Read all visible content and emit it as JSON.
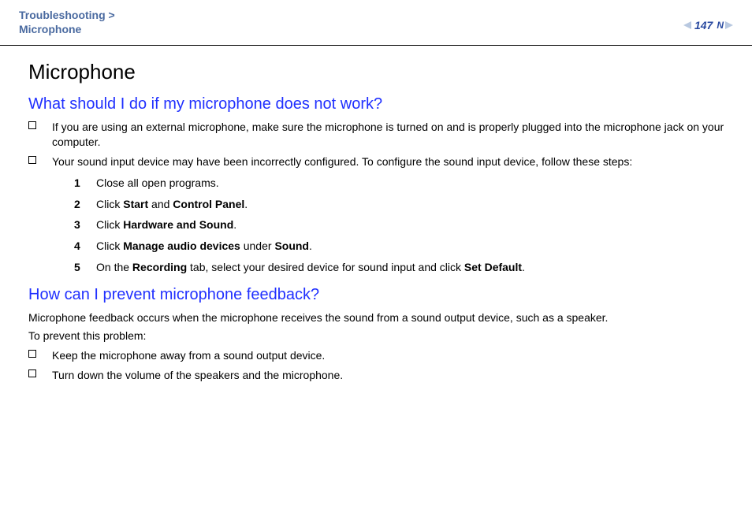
{
  "header": {
    "breadcrumb_section": "Troubleshooting",
    "breadcrumb_sep": ">",
    "breadcrumb_topic": "Microphone",
    "page_number": "147",
    "n_label": "N"
  },
  "content": {
    "title": "Microphone",
    "section1": {
      "heading": "What should I do if my microphone does not work?",
      "bullet1": "If you are using an external microphone, make sure the microphone is turned on and is properly plugged into the microphone jack on your computer.",
      "bullet2": "Your sound input device may have been incorrectly configured. To configure the sound input device, follow these steps:",
      "steps": {
        "s1": "Close all open programs.",
        "s2_pre": "Click ",
        "s2_b1": "Start",
        "s2_mid": " and ",
        "s2_b2": "Control Panel",
        "s2_post": ".",
        "s3_pre": "Click ",
        "s3_b1": "Hardware and Sound",
        "s3_post": ".",
        "s4_pre": "Click ",
        "s4_b1": "Manage audio devices",
        "s4_mid": " under ",
        "s4_b2": "Sound",
        "s4_post": ".",
        "s5_pre": "On the ",
        "s5_b1": "Recording",
        "s5_mid": " tab, select your desired device for sound input and click ",
        "s5_b2": "Set Default",
        "s5_post": "."
      }
    },
    "section2": {
      "heading": "How can I prevent microphone feedback?",
      "intro": "Microphone feedback occurs when the microphone receives the sound from a sound output device, such as a speaker.",
      "lead": "To prevent this problem:",
      "bullet1": "Keep the microphone away from a sound output device.",
      "bullet2": "Turn down the volume of the speakers and the microphone."
    }
  }
}
